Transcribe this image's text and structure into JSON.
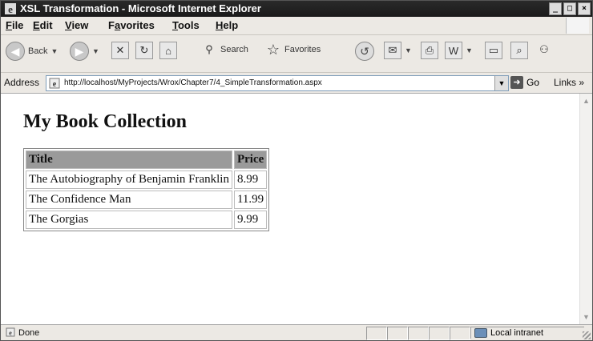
{
  "window": {
    "title": "XSL Transformation - Microsoft Internet Explorer",
    "controls": [
      "_",
      "□",
      "×"
    ]
  },
  "menu": {
    "items": [
      {
        "prefix": "",
        "ul": "F",
        "rest": "ile"
      },
      {
        "prefix": "",
        "ul": "E",
        "rest": "dit"
      },
      {
        "prefix": "",
        "ul": "V",
        "rest": "iew"
      },
      {
        "prefix": "F",
        "ul": "a",
        "rest": "vorites"
      },
      {
        "prefix": "",
        "ul": "T",
        "rest": "ools"
      },
      {
        "prefix": "",
        "ul": "H",
        "rest": "elp"
      }
    ]
  },
  "toolbar": {
    "back_label": "Back",
    "search_label": "Search",
    "favorites_label": "Favorites"
  },
  "address": {
    "label": "Address",
    "url": "http://localhost/MyProjects/Wrox/Chapter7/4_SimpleTransformation.aspx",
    "go_label": "Go",
    "links_label": "Links »"
  },
  "page": {
    "heading": "My Book Collection",
    "table": {
      "headers": [
        "Title",
        "Price"
      ],
      "rows": [
        [
          "The Autobiography of Benjamin Franklin",
          "8.99"
        ],
        [
          "The Confidence Man",
          "11.99"
        ],
        [
          "The Gorgias",
          "9.99"
        ]
      ]
    }
  },
  "status": {
    "text": "Done",
    "zone": "Local intranet"
  },
  "colors": {
    "title_bar": "#1e1e1e",
    "table_header_bg": "#9a9a9a"
  }
}
